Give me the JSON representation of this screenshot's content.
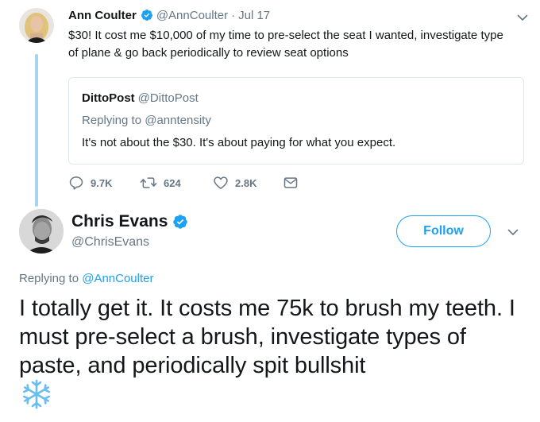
{
  "parent_tweet": {
    "name": "Ann Coulter",
    "handle": "@AnnCoulter",
    "separator": "·",
    "date": "Jul 17",
    "text": "$30!  It cost me $10,000 of my time to pre-select the seat I wanted, investigate type of plane & go back periodically to review seat options",
    "quote": {
      "name": "DittoPost",
      "handle": "@DittoPost",
      "replying_prefix": "Replying to ",
      "replying_to": "@anntensity",
      "text": "It's not about the $30. It's about paying for what you expect."
    },
    "actions": {
      "replies": "9.7K",
      "retweets": "624",
      "likes": "2.8K"
    }
  },
  "main_tweet": {
    "name": "Chris Evans",
    "handle": "@ChrisEvans",
    "follow_label": "Follow",
    "replying_prefix": "Replying to ",
    "replying_to": "@AnnCoulter",
    "text": "I totally get it. It costs me 75k to brush my teeth. I must pre-select a brush, investigate types of paste, and periodically spit bullshit",
    "emoji_icon": "snowflake-icon"
  },
  "colors": {
    "brand_blue": "#1da1f2",
    "thread_line": "#a6d4f2",
    "muted_text": "#657786",
    "border": "#e1e8ed"
  }
}
